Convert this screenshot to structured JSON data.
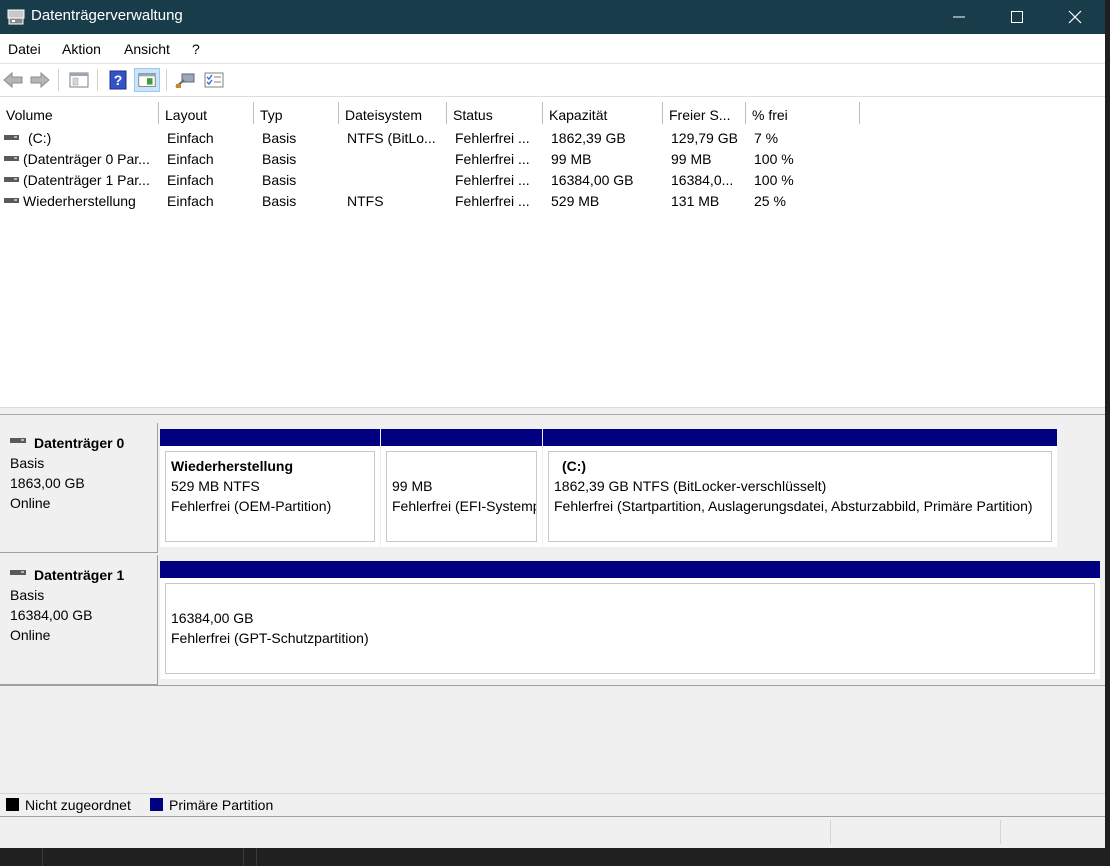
{
  "window": {
    "title": "Datenträgerverwaltung"
  },
  "menu": [
    "Datei",
    "Aktion",
    "Ansicht",
    "?"
  ],
  "columns": [
    "Volume",
    "Layout",
    "Typ",
    "Dateisystem",
    "Status",
    "Kapazität",
    "Freier S...",
    "% frei"
  ],
  "volumes": [
    {
      "volume": "(C:)",
      "layout": "Einfach",
      "type": "Basis",
      "fs": "NTFS (BitLo...",
      "status": "Fehlerfrei ...",
      "capacity": "1862,39 GB",
      "free": "129,79 GB",
      "pct": "7 %"
    },
    {
      "volume": "(Datenträger 0 Par...",
      "layout": "Einfach",
      "type": "Basis",
      "fs": "",
      "status": "Fehlerfrei ...",
      "capacity": "99 MB",
      "free": "99 MB",
      "pct": "100 %"
    },
    {
      "volume": "(Datenträger 1 Par...",
      "layout": "Einfach",
      "type": "Basis",
      "fs": "",
      "status": "Fehlerfrei ...",
      "capacity": "16384,00 GB",
      "free": "16384,0...",
      "pct": "100 %"
    },
    {
      "volume": "Wiederherstellung",
      "layout": "Einfach",
      "type": "Basis",
      "fs": "NTFS",
      "status": "Fehlerfrei ...",
      "capacity": "529 MB",
      "free": "131 MB",
      "pct": "25 %"
    }
  ],
  "disks": [
    {
      "name": "Datenträger 0",
      "type": "Basis",
      "size": "1863,00 GB",
      "state": "Online",
      "partitions": [
        {
          "title": "Wiederherstellung",
          "size": "529 MB NTFS",
          "status": "Fehlerfrei (OEM-Partition)"
        },
        {
          "title": "",
          "size": "99 MB",
          "status": "Fehlerfrei (EFI-Systempartition)"
        },
        {
          "title": "(C:)",
          "size": "1862,39 GB NTFS (BitLocker-verschlüsselt)",
          "status": "Fehlerfrei (Startpartition, Auslagerungsdatei, Absturzabbild, Primäre Partition)"
        }
      ]
    },
    {
      "name": "Datenträger 1",
      "type": "Basis",
      "size": "16384,00 GB",
      "state": "Online",
      "partitions": [
        {
          "title": "",
          "size": "16384,00 GB",
          "status": "Fehlerfrei (GPT-Schutzpartition)"
        }
      ]
    }
  ],
  "legend": [
    {
      "label": "Nicht zugeordnet",
      "color": "#000000"
    },
    {
      "label": "Primäre Partition",
      "color": "#000080"
    }
  ],
  "colors": {
    "titlebar": "#193c4a",
    "primary_partition": "#000080"
  },
  "icons": {
    "app": "disk-management-icon",
    "toolbar": [
      "back-icon",
      "forward-icon",
      "properties-window-icon",
      "help-icon",
      "show-pane-icon",
      "connect-icon",
      "checklist-icon"
    ],
    "window": [
      "minimize-icon",
      "maximize-icon",
      "close-icon"
    ]
  }
}
